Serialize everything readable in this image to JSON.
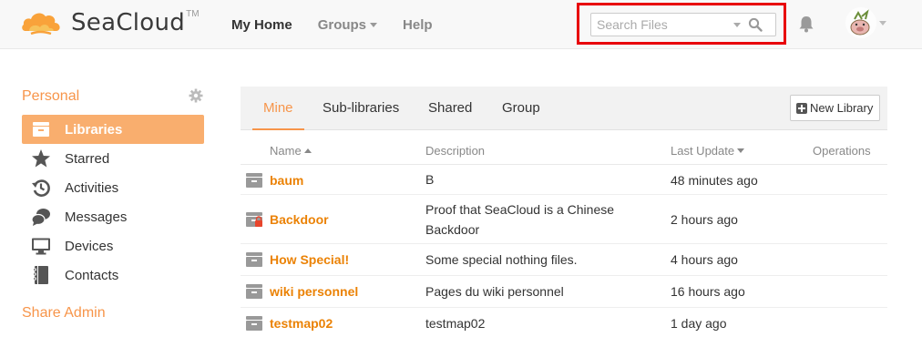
{
  "header": {
    "brand": "SeaCloud",
    "brand_tm": "TM",
    "nav": [
      {
        "label": "My Home"
      },
      {
        "label": "Groups"
      },
      {
        "label": "Help"
      }
    ],
    "search_placeholder": "Search Files",
    "highlight_color": "#e8000b"
  },
  "sidebar": {
    "personal_heading": "Personal",
    "items": [
      {
        "label": "Libraries",
        "icon": "library-icon"
      },
      {
        "label": "Starred",
        "icon": "star-icon"
      },
      {
        "label": "Activities",
        "icon": "clock-icon"
      },
      {
        "label": "Messages",
        "icon": "chat-bubbles-icon"
      },
      {
        "label": "Devices",
        "icon": "monitor-icon"
      },
      {
        "label": "Contacts",
        "icon": "address-book-icon"
      }
    ],
    "admin_heading": "Share Admin",
    "accent_color": "#f7954a"
  },
  "main": {
    "tabs": [
      {
        "label": "Mine"
      },
      {
        "label": "Sub-libraries"
      },
      {
        "label": "Shared"
      },
      {
        "label": "Group"
      }
    ],
    "new_library_label": "New Library",
    "columns": {
      "name": "Name",
      "description": "Description",
      "last_update": "Last Update",
      "operations": "Operations"
    },
    "rows": [
      {
        "name": "baum",
        "description": "B",
        "updated": "48 minutes ago",
        "encrypted": false
      },
      {
        "name": "Backdoor",
        "description": "Proof that SeaCloud is a Chinese Backdoor",
        "updated": "2 hours ago",
        "encrypted": true
      },
      {
        "name": "How Special!",
        "description": "Some special nothing files.",
        "updated": "4 hours ago",
        "encrypted": false
      },
      {
        "name": "wiki personnel",
        "description": "Pages du wiki personnel",
        "updated": "16 hours ago",
        "encrypted": false
      },
      {
        "name": "testmap02",
        "description": "testmap02",
        "updated": "1 day ago",
        "encrypted": false
      }
    ]
  }
}
